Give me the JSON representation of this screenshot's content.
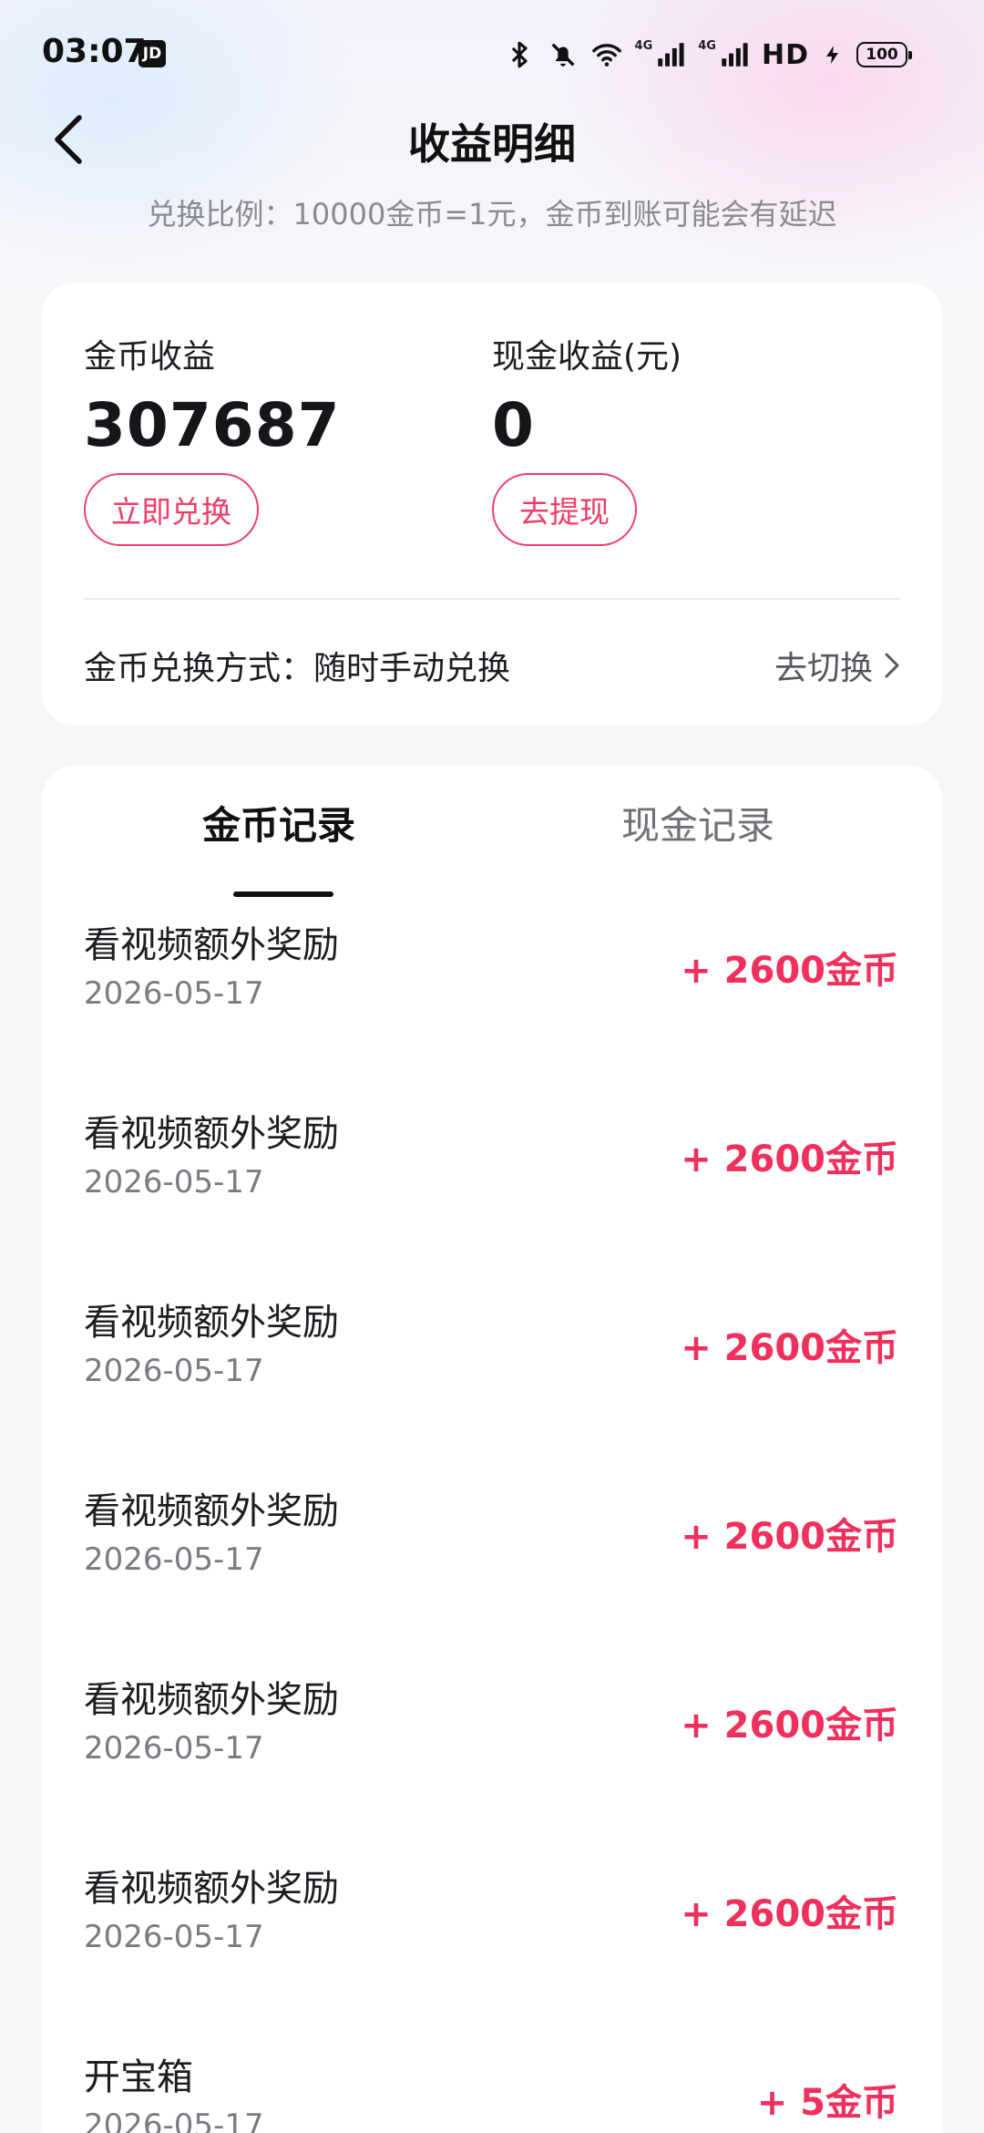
{
  "status_bar": {
    "time": "03:07",
    "app_badge": "JD",
    "network_label_1": "4G",
    "network_label_2": "4G",
    "hd_label": "HD",
    "battery": "100",
    "icons": [
      "bluetooth-icon",
      "mute-bell-icon",
      "wifi-icon",
      "signal-icon",
      "signal-icon",
      "charging-icon"
    ]
  },
  "header": {
    "title": "收益明细",
    "back_icon": "chevron-left-icon"
  },
  "subtitle": "兑换比例：10000金币=1元，金币到账可能会有延迟",
  "summary": {
    "coin": {
      "label": "金币收益",
      "value": "307687",
      "button": "立即兑换"
    },
    "cash": {
      "label": "现金收益(元)",
      "value": "0",
      "button": "去提现"
    },
    "exchange_method": "金币兑换方式：随时手动兑换",
    "switch_label": "去切换"
  },
  "tabs": [
    {
      "label": "金币记录",
      "active": true
    },
    {
      "label": "现金记录",
      "active": false
    }
  ],
  "records": [
    {
      "title": "看视频额外奖励",
      "date": "2026-05-17",
      "amount": "+ 2600金币"
    },
    {
      "title": "看视频额外奖励",
      "date": "2026-05-17",
      "amount": "+ 2600金币"
    },
    {
      "title": "看视频额外奖励",
      "date": "2026-05-17",
      "amount": "+ 2600金币"
    },
    {
      "title": "看视频额外奖励",
      "date": "2026-05-17",
      "amount": "+ 2600金币"
    },
    {
      "title": "看视频额外奖励",
      "date": "2026-05-17",
      "amount": "+ 2600金币"
    },
    {
      "title": "看视频额外奖励",
      "date": "2026-05-17",
      "amount": "+ 2600金币"
    },
    {
      "title": "开宝箱",
      "date": "2026-05-17",
      "amount": "+ 5金币"
    }
  ],
  "colors": {
    "accent": "#ef2f5c",
    "button_border": "#ef3e66",
    "text_primary": "#1c1c22",
    "text_secondary": "#7a7a82"
  }
}
